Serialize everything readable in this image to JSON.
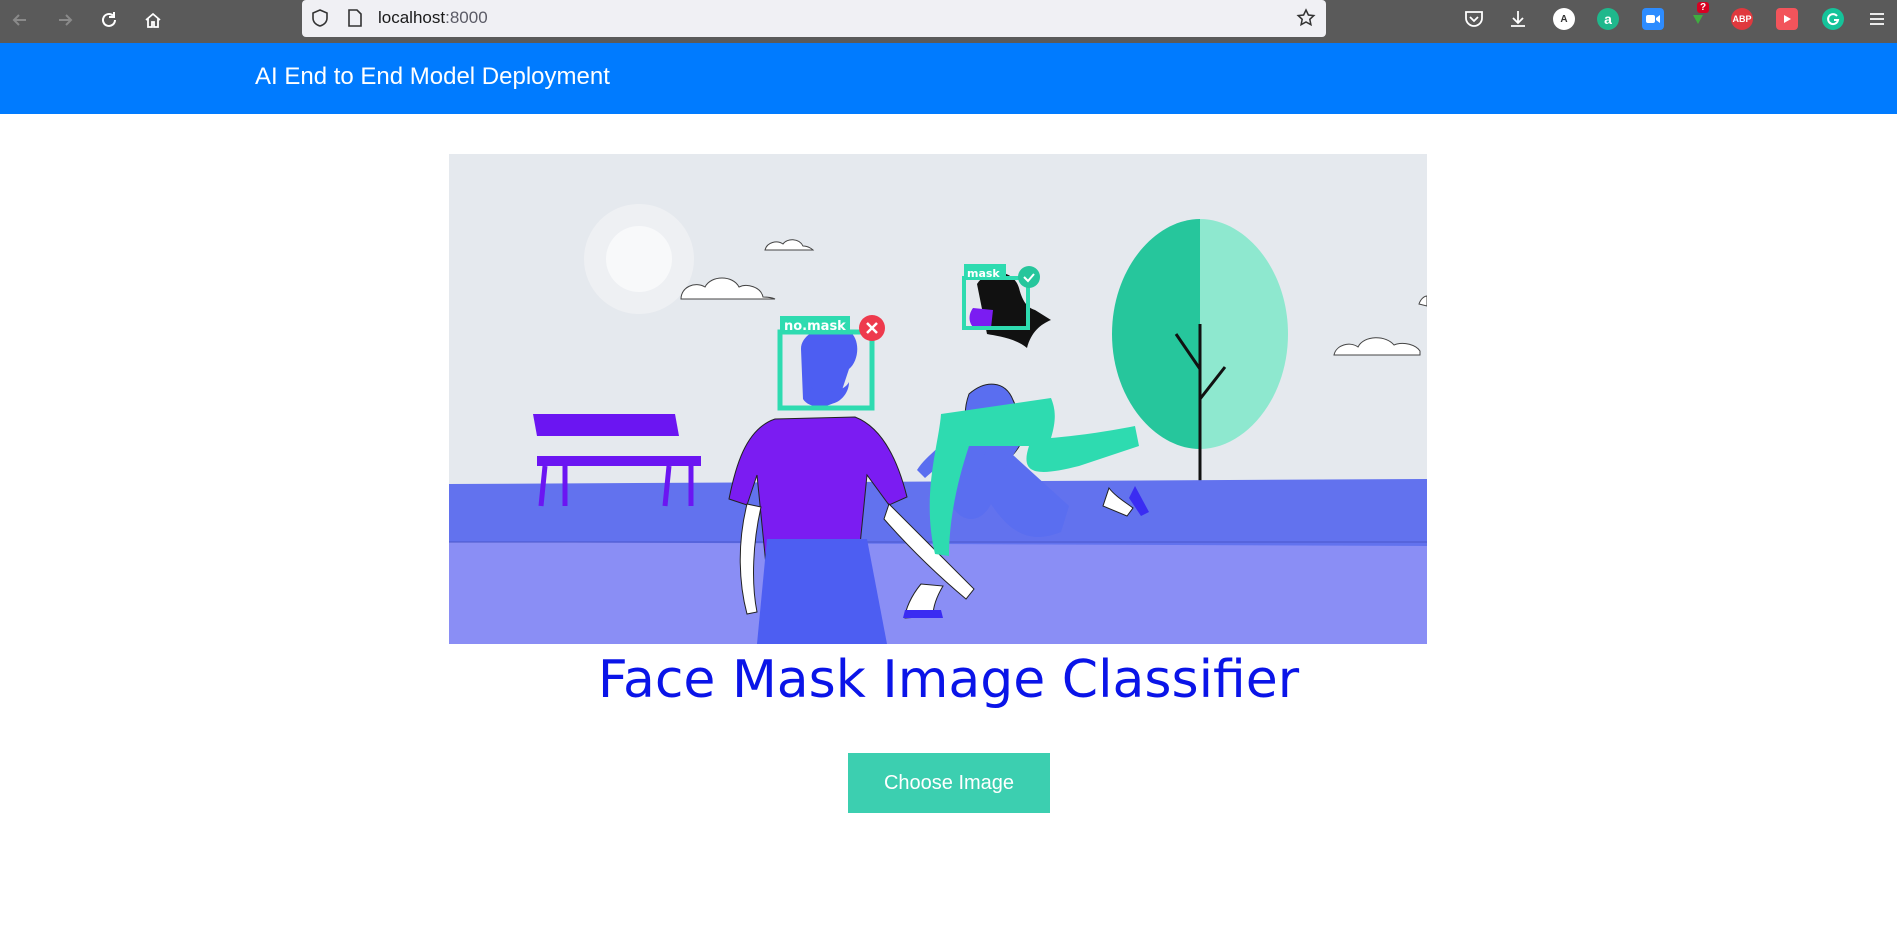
{
  "browser": {
    "url_host": "localhost",
    "url_port": ":8000",
    "extension_abp": "ABP",
    "extension_a": "A",
    "extension_amazon": "a",
    "extension_badge": "?"
  },
  "navbar": {
    "brand": "AI End to End Model Deployment"
  },
  "hero": {
    "label_no_mask": "no.mask",
    "label_mask": "mask"
  },
  "main": {
    "title": "Face Mask Image Classifier",
    "choose_button": "Choose Image"
  }
}
